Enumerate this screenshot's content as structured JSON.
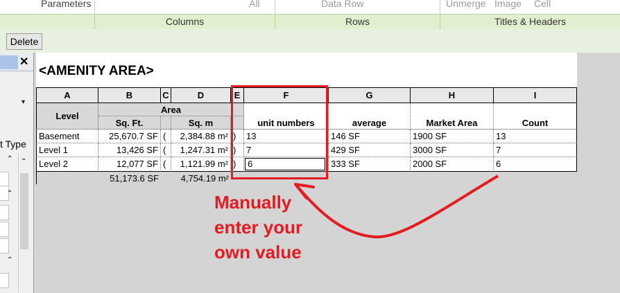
{
  "ribbon": {
    "top_labels": [
      "Parameters",
      "All",
      "Data Row",
      "Unmerge",
      "Image",
      "Cell"
    ],
    "groups": [
      "Columns",
      "Rows",
      "Titles & Headers"
    ]
  },
  "toolbar": {
    "delete_label": "Delete"
  },
  "leftpanel": {
    "close_glyph": "✕",
    "type_label": "t Type",
    "dropdown_glyph": "▾",
    "collapse_glyph": "⌃"
  },
  "schedule": {
    "title": "<AMENITY AREA>",
    "column_letters": [
      "A",
      "B",
      "C",
      "D",
      "E",
      "F",
      "G",
      "H",
      "I"
    ],
    "headers": {
      "level": "Level",
      "area": "Area",
      "sqft": "Sq. Ft.",
      "sqm": "Sq. m",
      "unit_numbers": "unit numbers",
      "average": "average",
      "market_area": "Market Area",
      "count": "Count"
    },
    "rows": [
      {
        "level": "Basement",
        "sqft": "25,670.7 SF",
        "c": "(",
        "sqm": "2,384.88 m²",
        "e": ")",
        "unit_numbers": "13",
        "average": "146 SF",
        "market_area": "1900 SF",
        "count": "13"
      },
      {
        "level": "Level 1",
        "sqft": "13,426 SF",
        "c": "(",
        "sqm": "1,247.31 m²",
        "e": ")",
        "unit_numbers": "7",
        "average": "429 SF",
        "market_area": "3000 SF",
        "count": "7"
      },
      {
        "level": "Level 2",
        "sqft": "12,077 SF",
        "c": "(",
        "sqm": "1,121.99 m²",
        "e": ")",
        "unit_numbers": "6",
        "average": "333 SF",
        "market_area": "2000 SF",
        "count": "6"
      }
    ],
    "totals": {
      "sqft": "51,173.6 SF",
      "sqm": "4,754.19 m²"
    }
  },
  "annotation": {
    "lines": [
      "Manually",
      "enter your",
      "own value"
    ],
    "color": "#e41b23"
  }
}
